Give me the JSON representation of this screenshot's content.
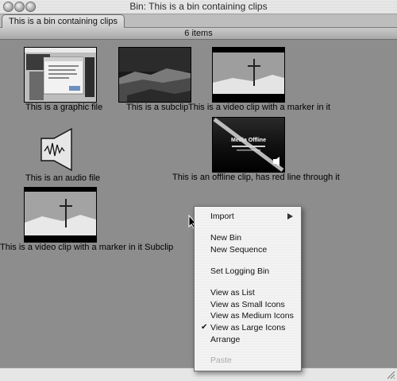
{
  "window": {
    "title": "Bin: This is a bin containing clips",
    "tab_label": "This is a bin containing clips",
    "item_count_label": "6 items"
  },
  "clips": [
    {
      "caption": "This is a graphic file",
      "kind": "graphic"
    },
    {
      "caption": "This is a subclip",
      "kind": "subclip"
    },
    {
      "caption": "This is a video clip with a marker in it",
      "kind": "video-marker"
    },
    {
      "caption": "This is an audio file",
      "kind": "audio"
    },
    {
      "caption": "This is an offline clip, has red line through it",
      "kind": "offline",
      "overlay_text": "Media Offline"
    },
    {
      "caption": "This is a video clip with a marker in it Subclip",
      "kind": "video-marker-subclip"
    }
  ],
  "context_menu": {
    "items": [
      {
        "label": "Import",
        "submenu": true
      },
      {
        "label": "New Bin"
      },
      {
        "label": "New Sequence"
      },
      {
        "label": "Set Logging Bin"
      },
      {
        "label": "View as List"
      },
      {
        "label": "View as Small Icons"
      },
      {
        "label": "View as Medium Icons"
      },
      {
        "label": "View as Large Icons",
        "checked": true
      },
      {
        "label": "Arrange"
      },
      {
        "label": "Paste",
        "disabled": true
      }
    ]
  },
  "icons": {
    "close": "traffic-light-close-icon",
    "minimize": "traffic-light-minimize-icon",
    "zoom": "traffic-light-zoom-icon",
    "audio": "speaker-waveform-icon",
    "submenu": "triangle-right-icon",
    "check": "checkmark-icon",
    "cursor": "mouse-pointer-icon",
    "resize": "resize-grip-icon"
  }
}
